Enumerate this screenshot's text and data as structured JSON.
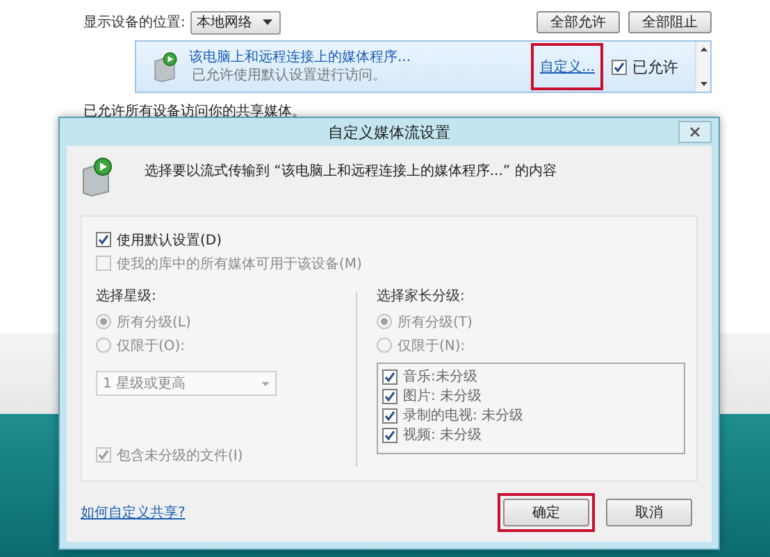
{
  "media_page": {
    "location_label": "显示设备的位置:",
    "location_dropdown": "本地网络",
    "buttons": [
      {
        "label": "全部允许"
      },
      {
        "label": "全部阻止"
      }
    ],
    "devices": [
      {
        "name": "该电脑上和远程连接上的媒体程序...",
        "status": "已允许使用默认设置进行访问。",
        "customize_link": "自定义...",
        "customize_highlighted": true,
        "allowed_label": "已允许",
        "allowed": true,
        "selected": true
      }
    ],
    "footer": "已允许所有设备访问你的共享媒体。"
  },
  "dialog": {
    "title": "自定义媒体流设置",
    "heading": "选择要以流式传输到 “该电脑上和远程连接上的媒体程序...” 的内容",
    "options": [
      {
        "label": "使用默认设置(D)",
        "checked": true,
        "disabled": false
      },
      {
        "label": "使我的库中的所有媒体可用于该设备(M)",
        "checked": false,
        "disabled": true
      }
    ],
    "star_group": {
      "title": "选择星级:",
      "radios": [
        {
          "label": "所有分级(L)",
          "selected": true
        },
        {
          "label": "仅限于(O):",
          "selected": false
        }
      ],
      "dropdown": "1 星级或更高",
      "include": {
        "label": "包含未分级的文件(I)",
        "checked": true
      }
    },
    "parental_group": {
      "title": "选择家长分级:",
      "radios": [
        {
          "label": "所有分级(T)",
          "selected": true
        },
        {
          "label": "仅限于(N):",
          "selected": false
        }
      ],
      "items": [
        {
          "label": "音乐:未分级",
          "checked": true
        },
        {
          "label": "图片: 未分级",
          "checked": true
        },
        {
          "label": "录制的电视: 未分级",
          "checked": true
        },
        {
          "label": "视频: 未分级",
          "checked": true
        }
      ]
    },
    "help_link": "如何自定义共享?",
    "buttons": [
      {
        "label": "确定",
        "highlighted": true
      },
      {
        "label": "取消",
        "highlighted": false
      }
    ]
  }
}
